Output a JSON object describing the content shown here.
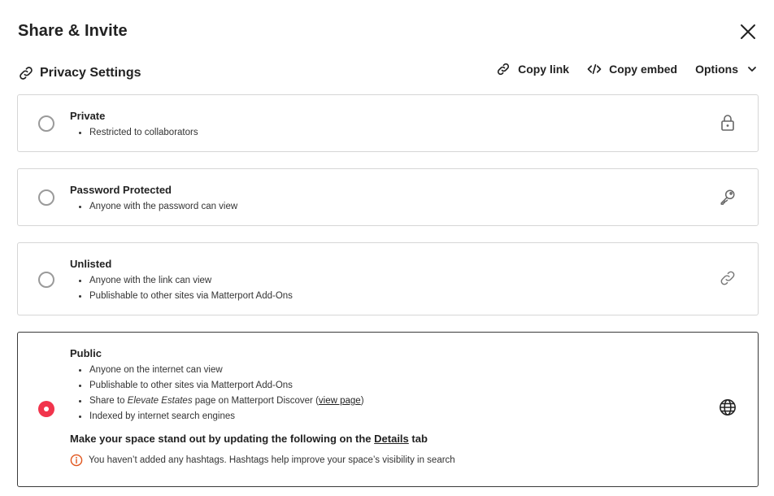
{
  "dialog": {
    "title": "Share & Invite"
  },
  "privacy": {
    "title": "Privacy Settings"
  },
  "actions": {
    "copy_link": "Copy link",
    "copy_embed": "Copy embed",
    "options": "Options"
  },
  "options": [
    {
      "title": "Private",
      "bullets": [
        "Restricted to collaborators"
      ],
      "icon": "lock-icon",
      "selected": false
    },
    {
      "title": "Password Protected",
      "bullets": [
        "Anyone with the password can view"
      ],
      "icon": "key-icon",
      "selected": false
    },
    {
      "title": "Unlisted",
      "bullets": [
        "Anyone with the link can view",
        "Publishable to other sites via Matterport Add-Ons"
      ],
      "icon": "link-icon",
      "selected": false
    },
    {
      "title": "Public",
      "bullets": [
        "Anyone on the internet can view",
        "Publishable to other sites via Matterport Add-Ons",
        "Indexed by internet search engines"
      ],
      "share": {
        "prefix": "Share to ",
        "name": "Elevate Estates",
        "middle": " page on Matterport Discover (",
        "link": "view page",
        "suffix": ")"
      },
      "cta": {
        "text": "Make your space stand out by updating the following on the ",
        "link": "Details",
        "suffix": " tab"
      },
      "warning": "You haven’t added any hashtags. Hashtags help improve your space’s visibility in search",
      "icon": "globe-icon",
      "selected": true
    }
  ],
  "colors": {
    "accent": "#f1344c",
    "warning": "#e0541b",
    "border": "#d6d6d6",
    "selected_border": "#3a3a3a"
  }
}
